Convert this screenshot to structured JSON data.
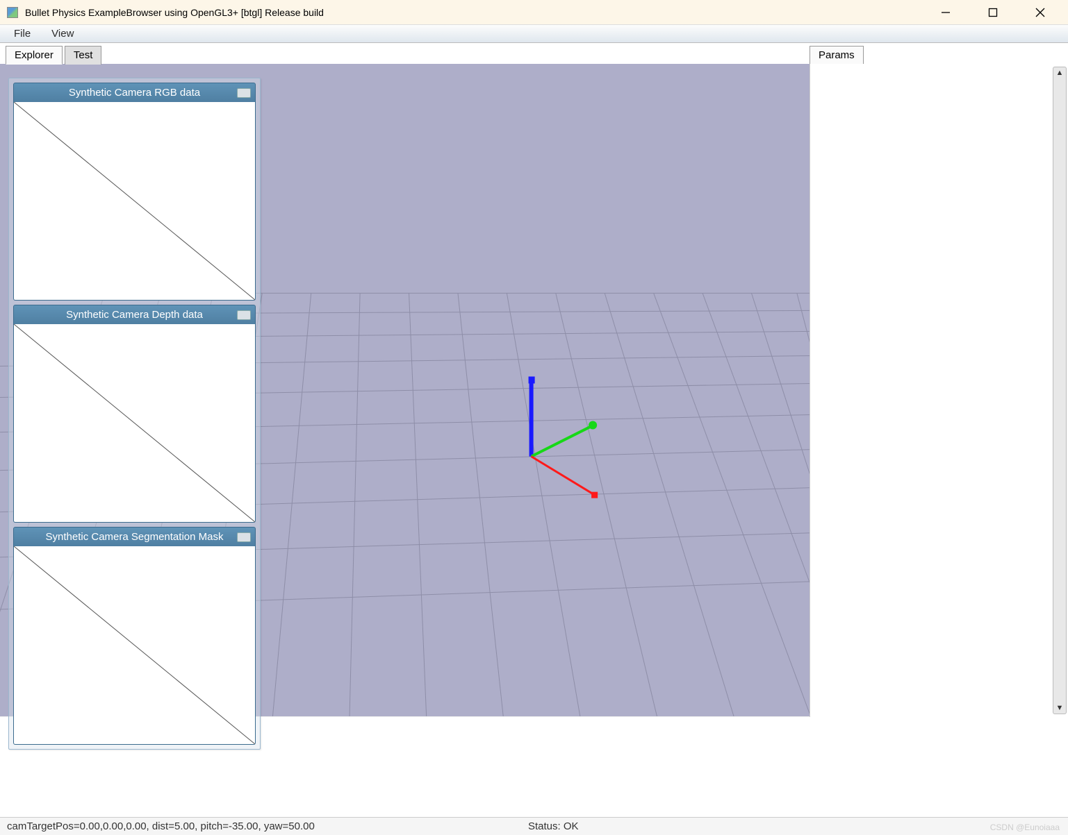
{
  "window": {
    "title": "Bullet Physics ExampleBrowser using OpenGL3+ [btgl] Release build"
  },
  "menu": {
    "file": "File",
    "view": "View"
  },
  "tabs": {
    "explorer": "Explorer",
    "test": "Test",
    "params": "Params"
  },
  "camera_panels": [
    {
      "title": "Synthetic Camera RGB data"
    },
    {
      "title": "Synthetic Camera Depth data"
    },
    {
      "title": "Synthetic Camera Segmentation Mask"
    }
  ],
  "viewport": {
    "axis_colors": {
      "x": "#ff1a1a",
      "y": "#17d817",
      "z": "#1a1aff"
    },
    "grid_color": "#8e8ea8",
    "bg_color": "#aeaec9"
  },
  "status": {
    "camera_info": "camTargetPos=0.00,0.00,0.00, dist=5.00, pitch=-35.00, yaw=50.00",
    "status_text": "Status: OK"
  },
  "watermark": "CSDN @Eunoiaaa"
}
